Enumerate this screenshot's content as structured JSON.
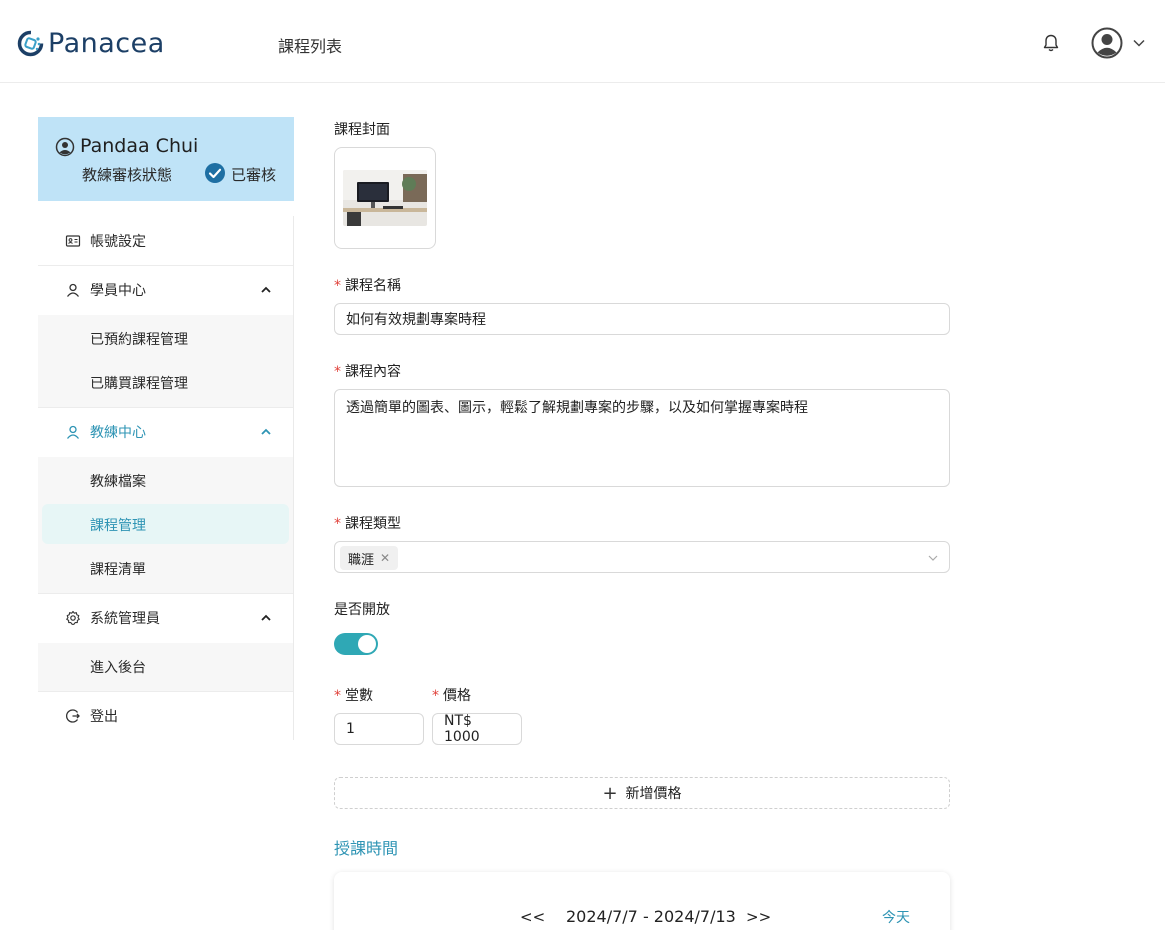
{
  "header": {
    "logo_text": "Panacea",
    "nav_link": "課程列表"
  },
  "profile": {
    "name": "Pandaa Chui",
    "status_label": "教練審核狀態",
    "status_value": "已審核"
  },
  "sidebar": {
    "account_settings": "帳號設定",
    "student_center": "學員中心",
    "student_items": [
      "已預約課程管理",
      "已購買課程管理"
    ],
    "coach_center": "教練中心",
    "coach_items": [
      "教練檔案",
      "課程管理",
      "課程清單"
    ],
    "admin": "系統管理員",
    "admin_items": [
      "進入後台"
    ],
    "logout": "登出"
  },
  "form": {
    "cover_label": "課程封面",
    "name_label": "課程名稱",
    "name_value": "如何有效規劃專案時程",
    "content_label": "課程內容",
    "content_value": "透過簡單的圖表、圖示，輕鬆了解規劃專案的步驟，以及如何掌握專案時程",
    "type_label": "課程類型",
    "type_tag": "職涯",
    "open_label": "是否開放",
    "open_value": true,
    "sessions_label": "堂數",
    "sessions_value": "1",
    "price_label": "價格",
    "price_value": "NT$ 1000",
    "add_price": "新增價格"
  },
  "schedule": {
    "title": "授課時間",
    "prev": "<<",
    "range": "2024/7/7 - 2024/7/13",
    "next": ">>",
    "today": "今天"
  },
  "colors": {
    "brand": "#1c3f66",
    "accent": "#2e94b4",
    "profile_bg": "#bfe3f7",
    "toggle_on": "#2fa8b5",
    "required": "#e0413a"
  },
  "icons": {
    "bell": "bell-icon",
    "avatar": "user-circle-icon",
    "chevron": "chevron-down-icon"
  }
}
